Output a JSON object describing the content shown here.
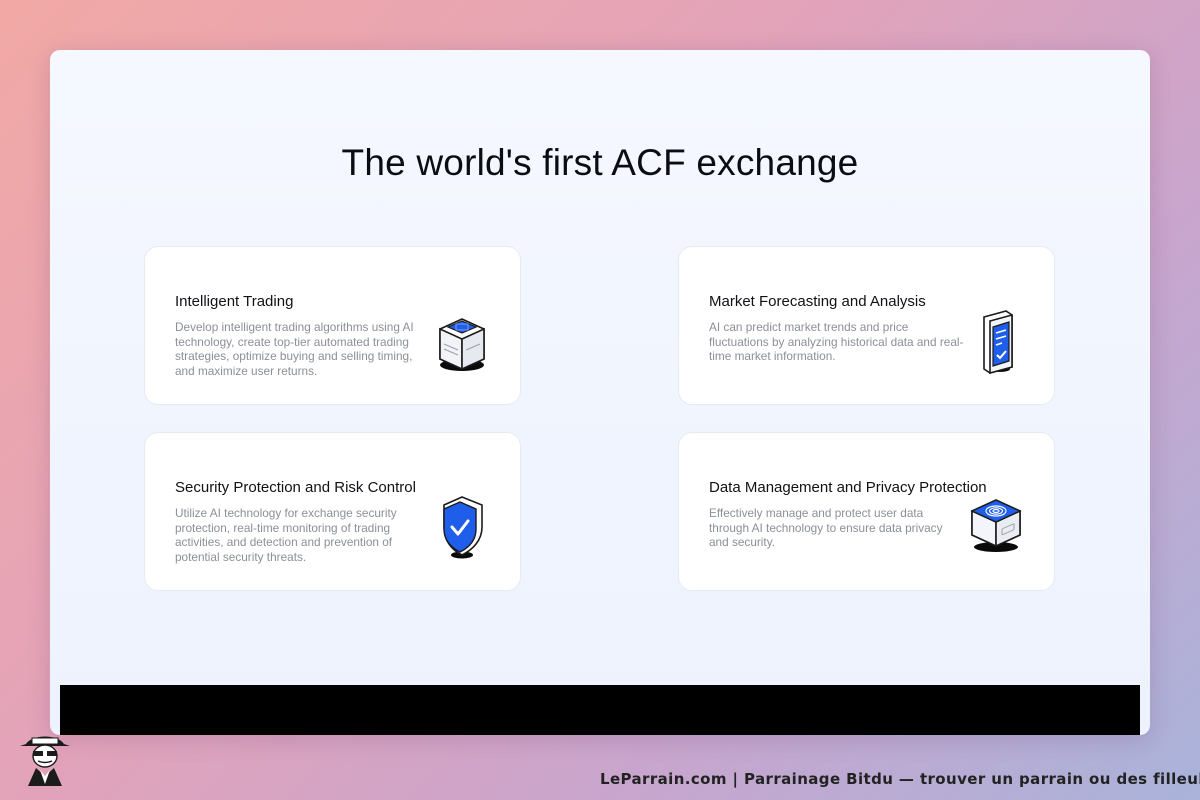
{
  "page": {
    "headline": "The world's first ACF exchange"
  },
  "features": [
    {
      "title": "Intelligent Trading",
      "description": "Develop intelligent trading algorithms using AI technology, create top-tier automated trading strategies, optimize buying and selling timing, and maximize user returns.",
      "icon": "server-chip-icon"
    },
    {
      "title": "Market Forecasting and Analysis",
      "description": "AI can predict market trends and price fluctuations by analyzing historical data and real-time market information.",
      "icon": "document-check-icon"
    },
    {
      "title": "Security Protection and Risk Control",
      "description": "Utilize AI technology for exchange security protection, real-time monitoring of trading activities, and detection and prevention of potential security threats.",
      "icon": "shield-check-icon"
    },
    {
      "title": "Data Management and Privacy Protection",
      "description": "Effectively manage and protect user data through AI technology to ensure data privacy and security.",
      "icon": "fingerprint-box-icon"
    }
  ],
  "watermark": {
    "text": "LeParrain.com | Parrainage Bitdu — trouver un parrain ou des filleuls",
    "logo": "mascot-logo"
  },
  "colors": {
    "accent": "#1f5eea",
    "title": "#101216",
    "muted": "#8b8f98"
  }
}
